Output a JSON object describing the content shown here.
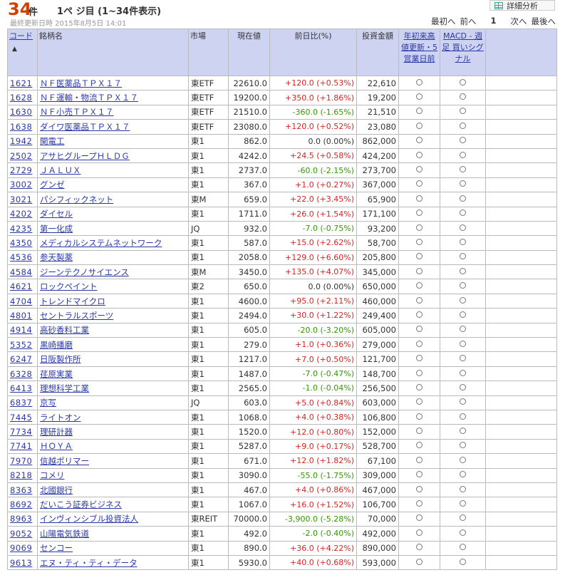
{
  "header": {
    "count": "34",
    "count_unit": "件",
    "page_info": "1ペ ジ目 (1~34件表示)",
    "updated": "最終更新日時  2015年8月5日 14:01",
    "detail_button": "詳細分析"
  },
  "pager": {
    "first": "最初へ",
    "prev": "前へ",
    "current": "1",
    "next": "次へ",
    "last": "最後へ"
  },
  "columns": {
    "code": "コード",
    "sort_arrow": "▲",
    "name": "銘柄名",
    "market": "市場",
    "price": "現在値",
    "change": "前日比(%)",
    "investment": "投資金額",
    "ytd_high": "年初来高値更新・5営業日前",
    "macd": "MACD - 週足 買いシグナル"
  },
  "rows": [
    {
      "code": "1621",
      "name": "ＮＦ医薬品ＴＰＸ１７",
      "market": "東ETF",
      "price": "22610.0",
      "change": "+120.0 (+0.53%)",
      "dir": "pos",
      "investment": "22,610"
    },
    {
      "code": "1628",
      "name": "ＮＦ運輸・物流ＴＰＸ１７",
      "market": "東ETF",
      "price": "19200.0",
      "change": "+350.0 (+1.86%)",
      "dir": "pos",
      "investment": "19,200"
    },
    {
      "code": "1630",
      "name": "ＮＦ小売ＴＰＸ１７",
      "market": "東ETF",
      "price": "21510.0",
      "change": "-360.0 (-1.65%)",
      "dir": "neg",
      "investment": "21,510"
    },
    {
      "code": "1638",
      "name": "ダイワ医薬品ＴＰＸ１７",
      "market": "東ETF",
      "price": "23080.0",
      "change": "+120.0 (+0.52%)",
      "dir": "pos",
      "investment": "23,080"
    },
    {
      "code": "1942",
      "name": "関電工",
      "market": "東1",
      "price": "862.0",
      "change": "0.0 (0.00%)",
      "dir": "zero",
      "investment": "862,000"
    },
    {
      "code": "2502",
      "name": "アサヒグループＨＬＤＧ",
      "market": "東1",
      "price": "4242.0",
      "change": "+24.5 (+0.58%)",
      "dir": "pos",
      "investment": "424,200"
    },
    {
      "code": "2729",
      "name": "ＪＡＬＵＸ",
      "market": "東1",
      "price": "2737.0",
      "change": "-60.0 (-2.15%)",
      "dir": "neg",
      "investment": "273,700"
    },
    {
      "code": "3002",
      "name": "グンゼ",
      "market": "東1",
      "price": "367.0",
      "change": "+1.0 (+0.27%)",
      "dir": "pos",
      "investment": "367,000"
    },
    {
      "code": "3021",
      "name": "パシフィックネット",
      "market": "東M",
      "price": "659.0",
      "change": "+22.0 (+3.45%)",
      "dir": "pos",
      "investment": "65,900"
    },
    {
      "code": "4202",
      "name": "ダイセル",
      "market": "東1",
      "price": "1711.0",
      "change": "+26.0 (+1.54%)",
      "dir": "pos",
      "investment": "171,100"
    },
    {
      "code": "4235",
      "name": "第一化成",
      "market": "JQ",
      "price": "932.0",
      "change": "-7.0 (-0.75%)",
      "dir": "neg",
      "investment": "93,200"
    },
    {
      "code": "4350",
      "name": "メディカルシステムネットワーク",
      "market": "東1",
      "price": "587.0",
      "change": "+15.0 (+2.62%)",
      "dir": "pos",
      "investment": "58,700"
    },
    {
      "code": "4536",
      "name": "参天製薬",
      "market": "東1",
      "price": "2058.0",
      "change": "+129.0 (+6.60%)",
      "dir": "pos",
      "investment": "205,800"
    },
    {
      "code": "4584",
      "name": "ジーンテクノサイエンス",
      "market": "東M",
      "price": "3450.0",
      "change": "+135.0 (+4.07%)",
      "dir": "pos",
      "investment": "345,000"
    },
    {
      "code": "4621",
      "name": "ロックペイント",
      "market": "東2",
      "price": "650.0",
      "change": "0.0 (0.00%)",
      "dir": "zero",
      "investment": "650,000"
    },
    {
      "code": "4704",
      "name": "トレンドマイクロ",
      "market": "東1",
      "price": "4600.0",
      "change": "+95.0 (+2.11%)",
      "dir": "pos",
      "investment": "460,000"
    },
    {
      "code": "4801",
      "name": "セントラルスポーツ",
      "market": "東1",
      "price": "2494.0",
      "change": "+30.0 (+1.22%)",
      "dir": "pos",
      "investment": "249,400"
    },
    {
      "code": "4914",
      "name": "高砂香料工業",
      "market": "東1",
      "price": "605.0",
      "change": "-20.0 (-3.20%)",
      "dir": "neg",
      "investment": "605,000"
    },
    {
      "code": "5352",
      "name": "黒崎播磨",
      "market": "東1",
      "price": "279.0",
      "change": "+1.0 (+0.36%)",
      "dir": "pos",
      "investment": "279,000"
    },
    {
      "code": "6247",
      "name": "日阪製作所",
      "market": "東1",
      "price": "1217.0",
      "change": "+7.0 (+0.50%)",
      "dir": "pos",
      "investment": "121,700"
    },
    {
      "code": "6328",
      "name": "荏原実業",
      "market": "東1",
      "price": "1487.0",
      "change": "-7.0 (-0.47%)",
      "dir": "neg",
      "investment": "148,700"
    },
    {
      "code": "6413",
      "name": "理想科学工業",
      "market": "東1",
      "price": "2565.0",
      "change": "-1.0 (-0.04%)",
      "dir": "neg",
      "investment": "256,500"
    },
    {
      "code": "6837",
      "name": "京写",
      "market": "JQ",
      "price": "603.0",
      "change": "+5.0 (+0.84%)",
      "dir": "pos",
      "investment": "603,000"
    },
    {
      "code": "7445",
      "name": "ライトオン",
      "market": "東1",
      "price": "1068.0",
      "change": "+4.0 (+0.38%)",
      "dir": "pos",
      "investment": "106,800"
    },
    {
      "code": "7734",
      "name": "理研計器",
      "market": "東1",
      "price": "1520.0",
      "change": "+12.0 (+0.80%)",
      "dir": "pos",
      "investment": "152,000"
    },
    {
      "code": "7741",
      "name": "ＨＯＹＡ",
      "market": "東1",
      "price": "5287.0",
      "change": "+9.0 (+0.17%)",
      "dir": "pos",
      "investment": "528,700"
    },
    {
      "code": "7970",
      "name": "信越ポリマー",
      "market": "東1",
      "price": "671.0",
      "change": "+12.0 (+1.82%)",
      "dir": "pos",
      "investment": "67,100"
    },
    {
      "code": "8218",
      "name": "コメリ",
      "market": "東1",
      "price": "3090.0",
      "change": "-55.0 (-1.75%)",
      "dir": "neg",
      "investment": "309,000"
    },
    {
      "code": "8363",
      "name": "北國銀行",
      "market": "東1",
      "price": "467.0",
      "change": "+4.0 (+0.86%)",
      "dir": "pos",
      "investment": "467,000"
    },
    {
      "code": "8692",
      "name": "だいこう証券ビジネス",
      "market": "東1",
      "price": "1067.0",
      "change": "+16.0 (+1.52%)",
      "dir": "pos",
      "investment": "106,700"
    },
    {
      "code": "8963",
      "name": "インヴィンシブル投資法人",
      "market": "東REIT",
      "price": "70000.0",
      "change": "-3,900.0 (-5.28%)",
      "dir": "neg",
      "investment": "70,000"
    },
    {
      "code": "9052",
      "name": "山陽電気鉄道",
      "market": "東1",
      "price": "492.0",
      "change": "-2.0 (-0.40%)",
      "dir": "neg",
      "investment": "492,000"
    },
    {
      "code": "9069",
      "name": "センコー",
      "market": "東1",
      "price": "890.0",
      "change": "+36.0 (+4.22%)",
      "dir": "pos",
      "investment": "890,000"
    },
    {
      "code": "9613",
      "name": "エヌ・ティ・ティ・データ",
      "market": "東1",
      "price": "5930.0",
      "change": "+40.0 (+0.68%)",
      "dir": "pos",
      "investment": "593,000"
    }
  ]
}
